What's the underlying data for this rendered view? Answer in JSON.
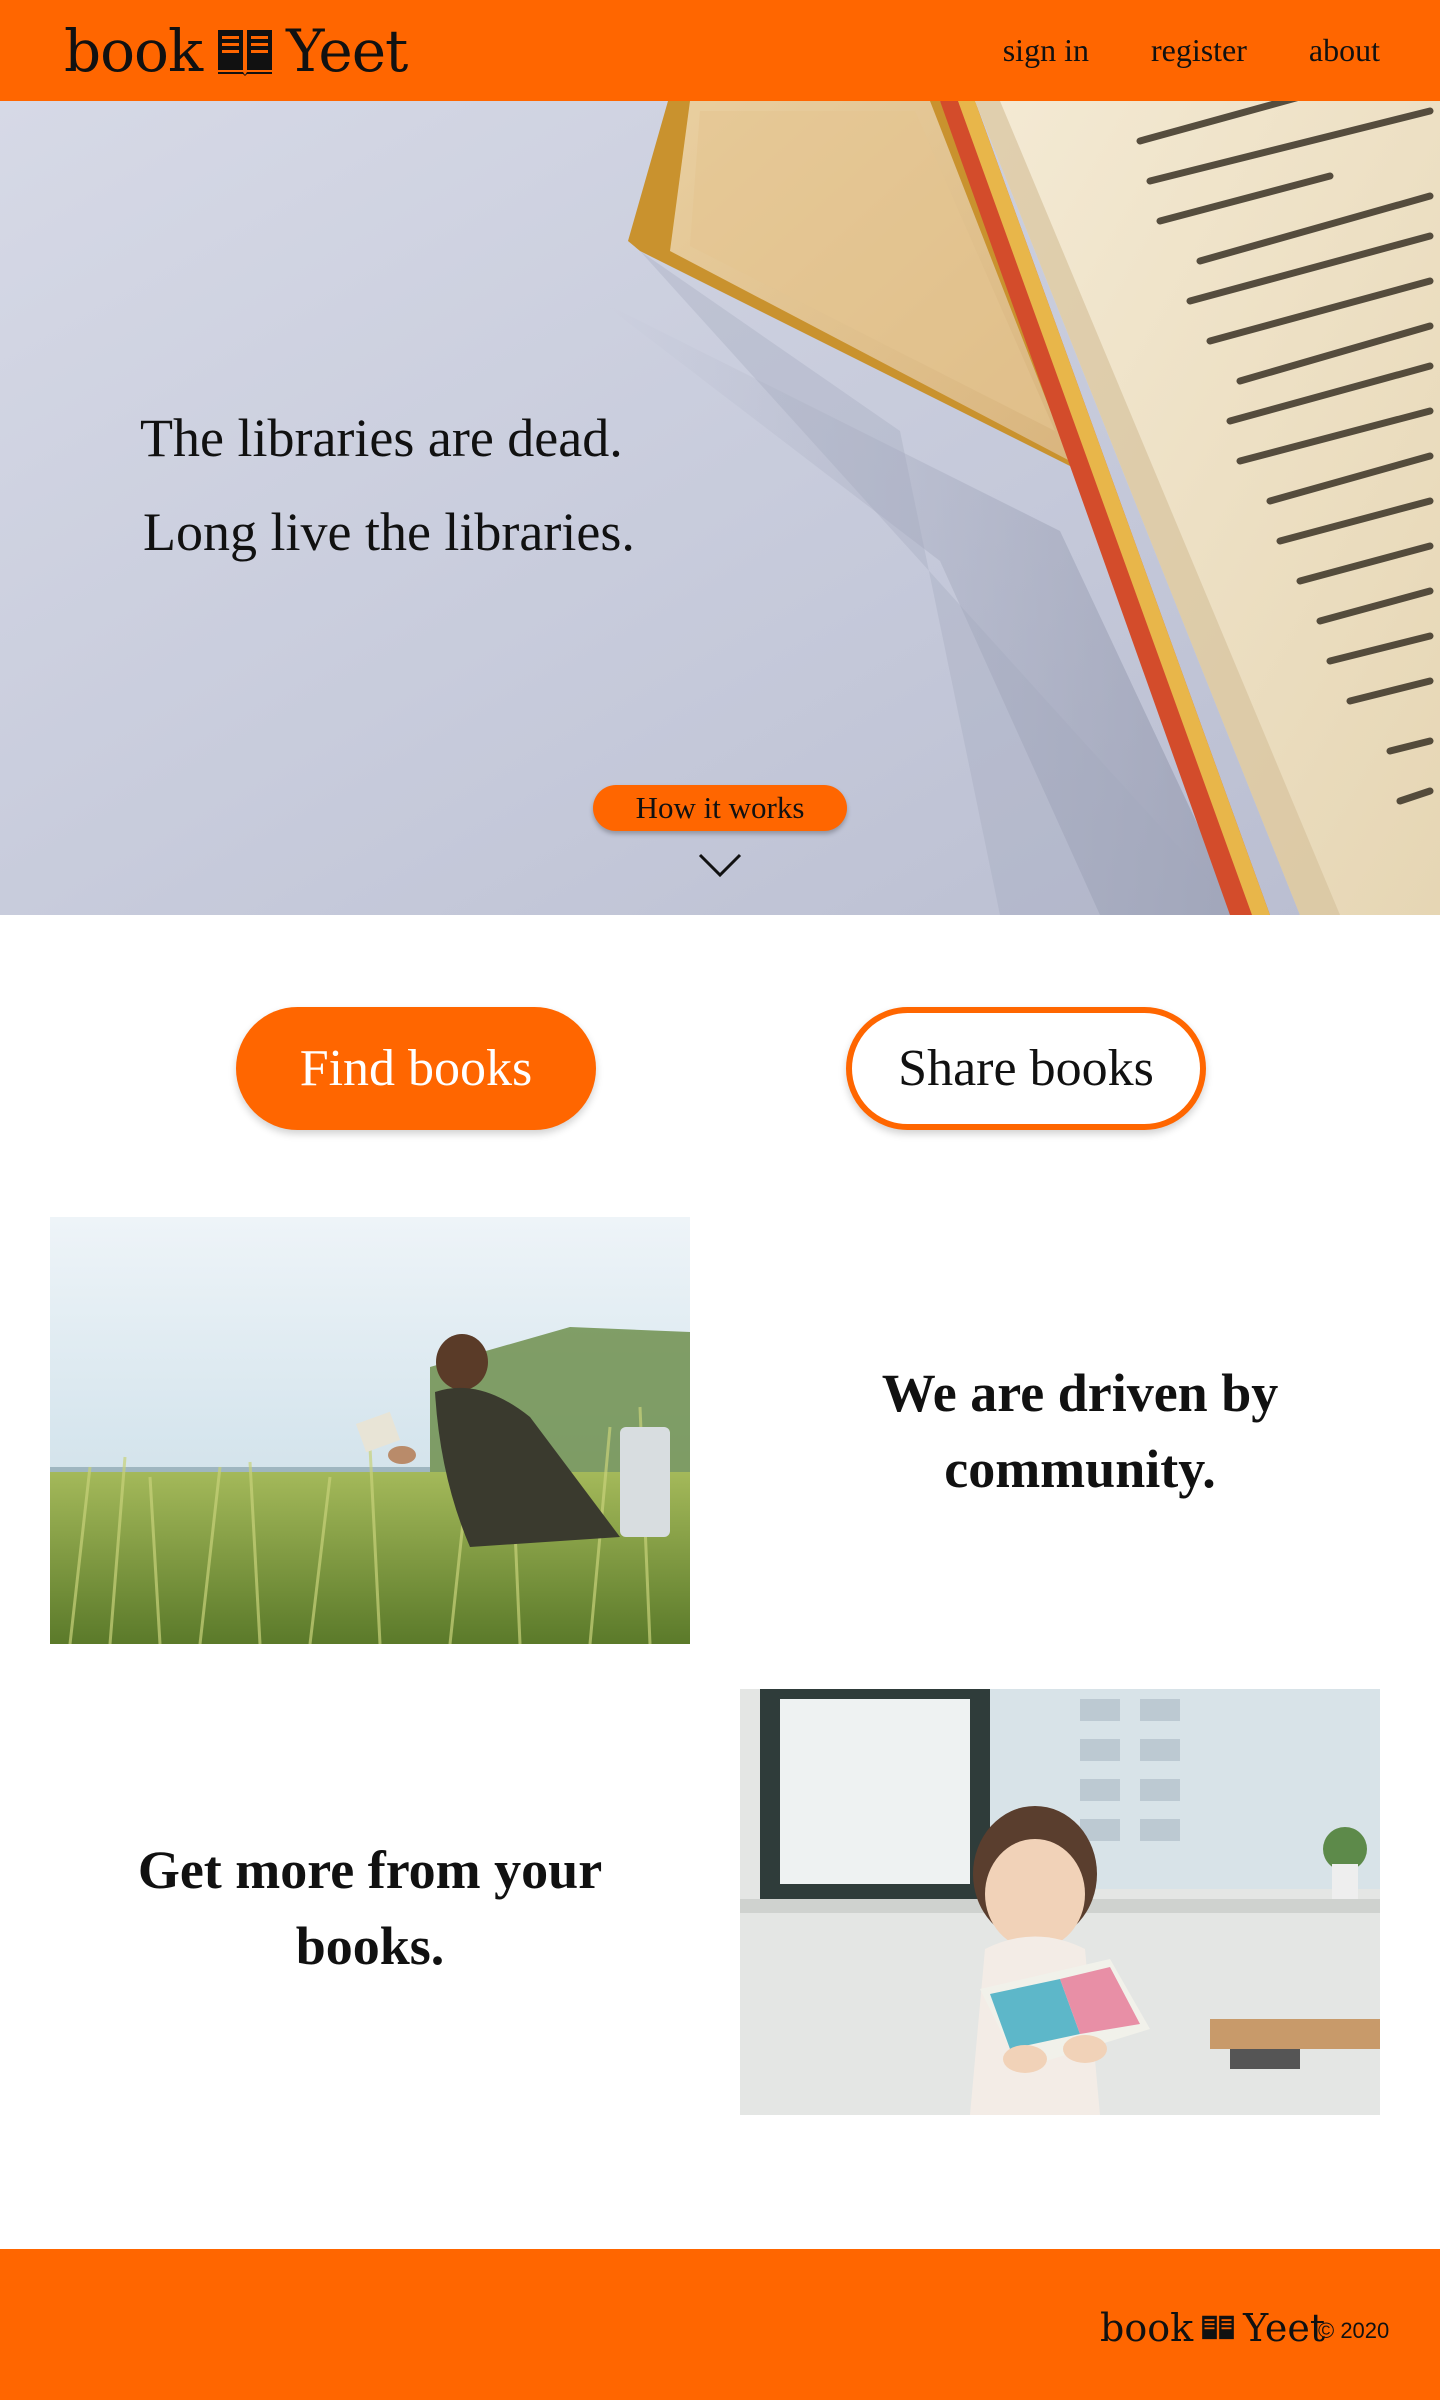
{
  "brand": {
    "word1": "book",
    "word2": "Yeet",
    "icon": "open-book-icon"
  },
  "nav": [
    {
      "label": "sign in"
    },
    {
      "label": "register"
    },
    {
      "label": "about"
    }
  ],
  "hero": {
    "line1": "The libraries are dead.",
    "line2": "Long live the libraries.",
    "how_label": "How it works"
  },
  "cta": {
    "find_label": "Find books",
    "share_label": "Share books"
  },
  "features": [
    {
      "text_line1": "We are driven by",
      "text_line2": "community."
    },
    {
      "text_line1": "Get more from your",
      "text_line2": "books."
    }
  ],
  "footer": {
    "copyright": "© 2020"
  },
  "colors": {
    "accent": "#ff6600",
    "text": "#111111",
    "background": "#ffffff"
  }
}
